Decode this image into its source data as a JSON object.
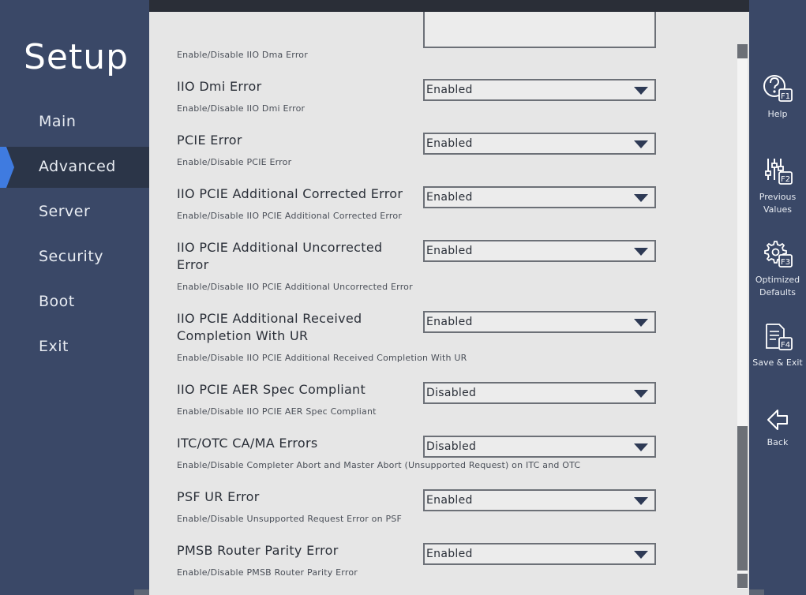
{
  "app": {
    "title": "Setup"
  },
  "nav": {
    "items": [
      {
        "label": "Main",
        "active": false
      },
      {
        "label": "Advanced",
        "active": true
      },
      {
        "label": "Server",
        "active": false
      },
      {
        "label": "Security",
        "active": false
      },
      {
        "label": "Boot",
        "active": false
      },
      {
        "label": "Exit",
        "active": false
      }
    ]
  },
  "function_keys": [
    {
      "key": "F1",
      "label": "Help",
      "icon": "help-icon"
    },
    {
      "key": "F2",
      "label": "Previous\nValues",
      "icon": "sliders-icon"
    },
    {
      "key": "F3",
      "label": "Optimized\nDefaults",
      "icon": "gear-icon"
    },
    {
      "key": "F4",
      "label": "Save & Exit",
      "icon": "save-document-icon"
    },
    {
      "key": "",
      "label": "Back",
      "icon": "back-arrow-icon"
    }
  ],
  "partial_setting": {
    "desc": "Enable/Disable IIO Dma Error"
  },
  "settings": [
    {
      "name": "IIO Dmi Error",
      "desc": "Enable/Disable IIO Dmi Error",
      "value": "Enabled"
    },
    {
      "name": "PCIE Error",
      "desc": "Enable/Disable PCIE Error",
      "value": "Enabled"
    },
    {
      "name": "IIO PCIE Additional Corrected Error",
      "desc": "Enable/Disable IIO PCIE Additional Corrected Error",
      "value": "Enabled"
    },
    {
      "name": "IIO PCIE Additional Uncorrected Error",
      "desc": "Enable/Disable IIO PCIE Additional Uncorrected Error",
      "value": "Enabled"
    },
    {
      "name": "IIO PCIE Additional Received Completion With UR",
      "desc": "Enable/Disable IIO PCIE Additional Received Completion With UR",
      "value": "Enabled"
    },
    {
      "name": "IIO PCIE AER Spec Compliant",
      "desc": "Enable/Disable IIO PCIE AER Spec Compliant",
      "value": "Disabled"
    },
    {
      "name": "ITC/OTC CA/MA Errors",
      "desc": "Enable/Disable Completer Abort and Master Abort (Unsupported Request) on ITC and OTC",
      "value": "Disabled"
    },
    {
      "name": "PSF UR Error",
      "desc": "Enable/Disable Unsupported Request Error on PSF",
      "value": "Enabled"
    },
    {
      "name": "PMSB Router Parity Error",
      "desc": "Enable/Disable PMSB Router Parity Error",
      "value": "Enabled"
    }
  ],
  "colors": {
    "accent": "#3f7be0",
    "nav_bg": "#3a4867",
    "nav_active_bg": "#2b3548",
    "panel_bg": "#e6e6e6"
  }
}
